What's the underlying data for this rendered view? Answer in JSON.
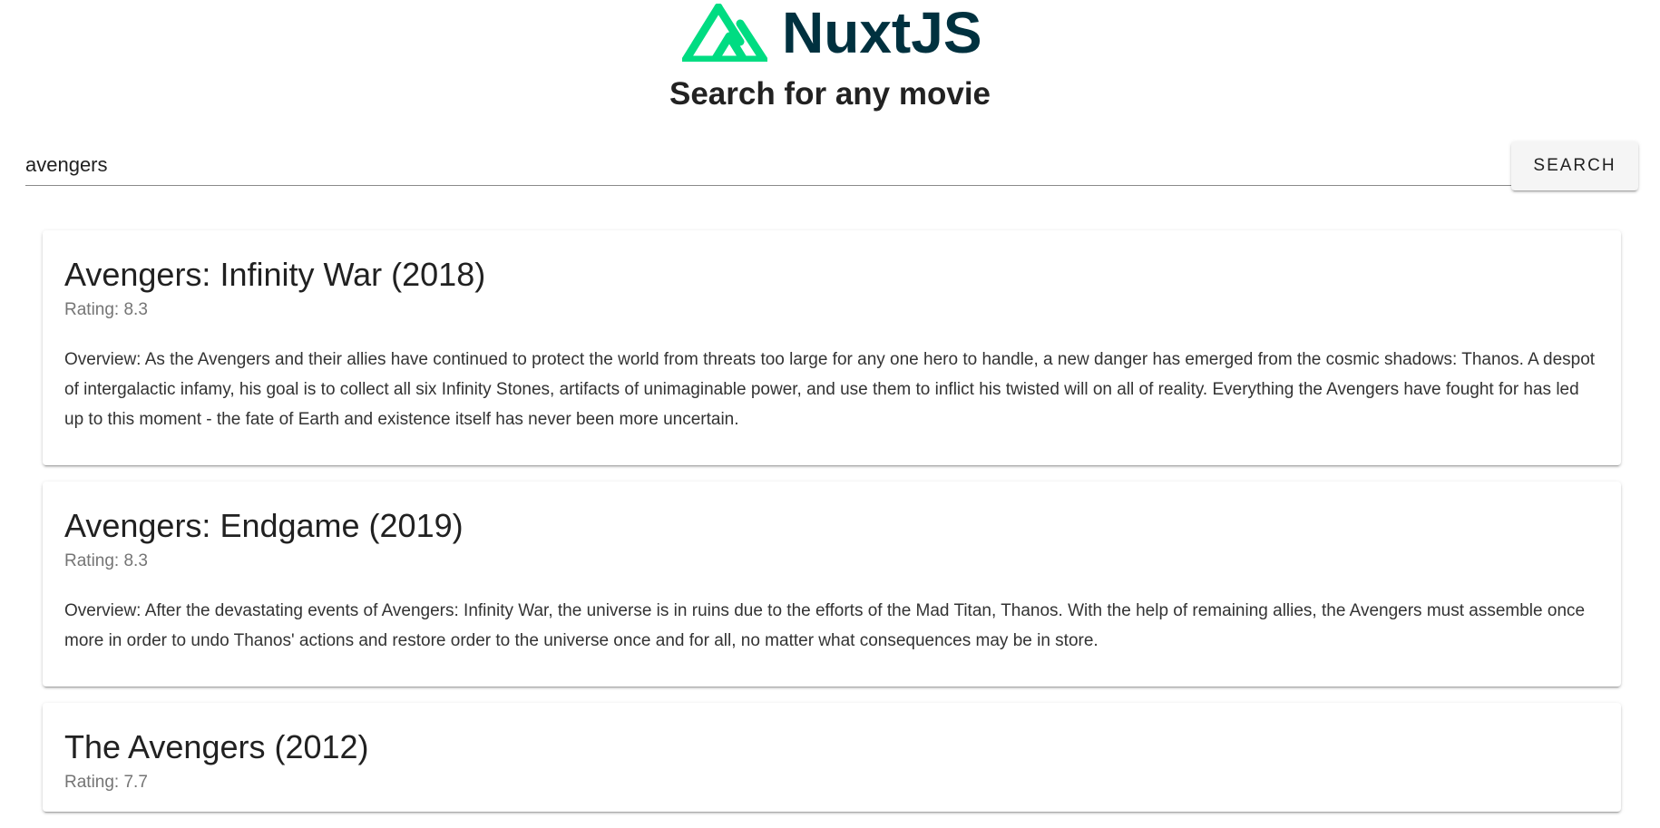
{
  "logo": {
    "icon": "nuxt-logo-icon",
    "text": "NuxtJS",
    "colors": {
      "green": "#00dc82",
      "dark": "#00313f"
    }
  },
  "page": {
    "title": "Search for any movie"
  },
  "search": {
    "value": "avengers",
    "placeholder": "",
    "button_label": "SEARCH"
  },
  "results": [
    {
      "title": "Avengers: Infinity War (2018)",
      "rating": "Rating: 8.3",
      "overview": "Overview: As the Avengers and their allies have continued to protect the world from threats too large for any one hero to handle, a new danger has emerged from the cosmic shadows: Thanos. A despot of intergalactic infamy, his goal is to collect all six Infinity Stones, artifacts of unimaginable power, and use them to inflict his twisted will on all of reality. Everything the Avengers have fought for has led up to this moment - the fate of Earth and existence itself has never been more uncertain."
    },
    {
      "title": "Avengers: Endgame (2019)",
      "rating": "Rating: 8.3",
      "overview": "Overview: After the devastating events of Avengers: Infinity War, the universe is in ruins due to the efforts of the Mad Titan, Thanos. With the help of remaining allies, the Avengers must assemble once more in order to undo Thanos' actions and restore order to the universe once and for all, no matter what consequences may be in store."
    },
    {
      "title": "The Avengers (2012)",
      "rating": "Rating: 7.7"
    }
  ]
}
